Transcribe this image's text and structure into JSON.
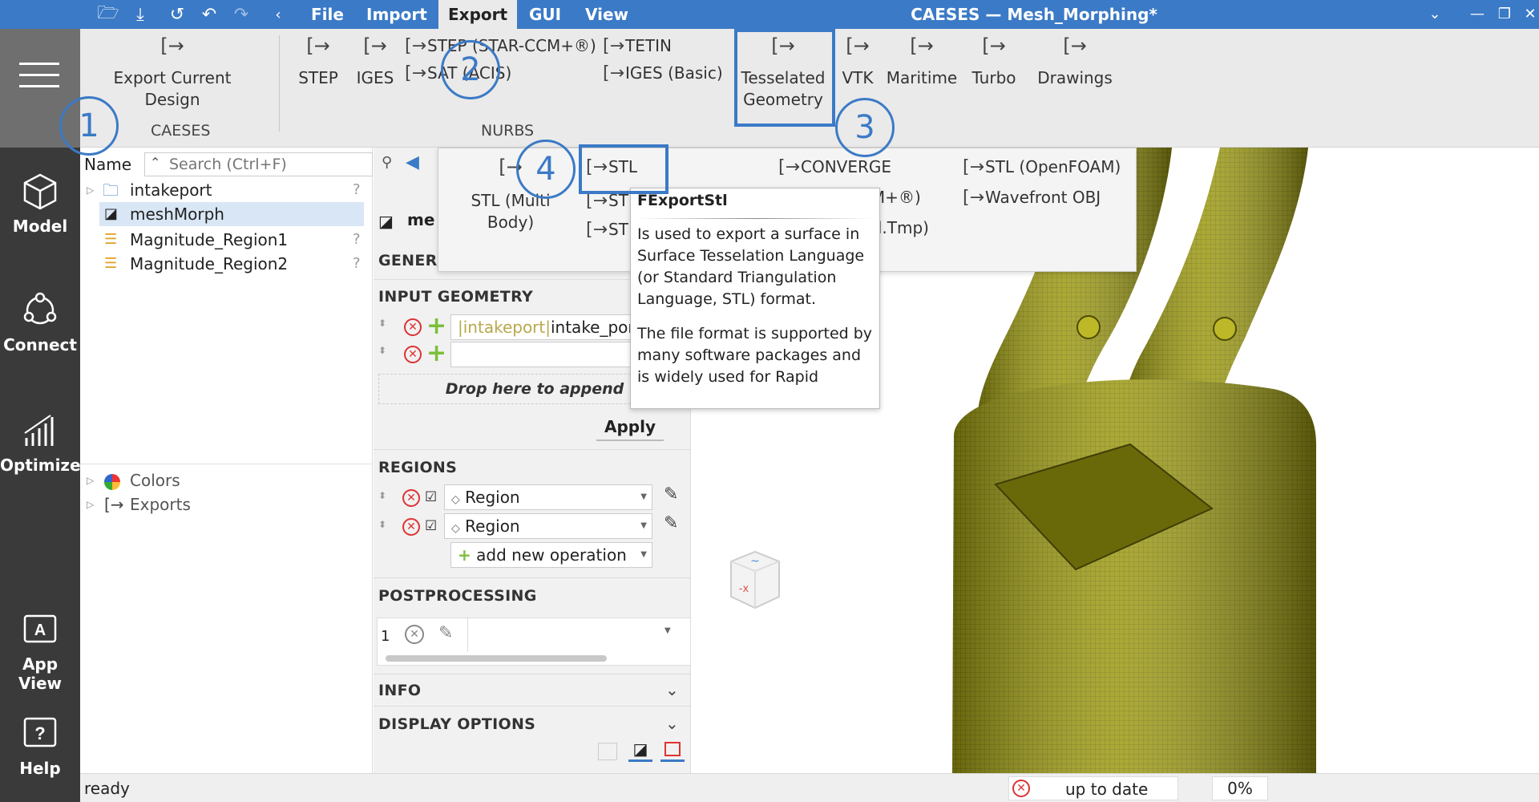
{
  "title_bar": {
    "menus": [
      "File",
      "Import",
      "Export",
      "GUI",
      "View"
    ],
    "title": "CAESES — Mesh_Morphing*"
  },
  "ribbon": {
    "caeses_group": {
      "export_current": "Export Current Design",
      "label": "CAESES"
    },
    "step": "STEP",
    "iges": "IGES",
    "step_star": "STEP (STAR-CCM+®)",
    "sat": "SAT (ACIS)",
    "tetin": "TETIN",
    "iges_basic": "IGES (Basic)",
    "nurbs_label": "NURBS",
    "tesselated": "Tesselated Geometry",
    "vtk": "VTK",
    "maritime": "Maritime",
    "turbo": "Turbo",
    "drawings": "Drawings"
  },
  "markers": [
    "1",
    "2",
    "3",
    "4"
  ],
  "sidebar": {
    "model": "Model",
    "connect": "Connect",
    "optimize": "Optimize",
    "app_view": "App View",
    "help": "Help"
  },
  "tree": {
    "name_header": "Name",
    "search_placeholder": "Search (Ctrl+F)",
    "items": [
      "intakeport",
      "meshMorph",
      "Magnitude_Region1",
      "Magnitude_Region2"
    ],
    "bottom_items": [
      "Colors",
      "Exports"
    ]
  },
  "dropdown": {
    "stl_multi": "STL (Multi Body)",
    "stl": "STL",
    "st2": "ST",
    "st3": "ST",
    "converge": "CONVERGE",
    "star_frag": "CCM+®)",
    "tmp_frag": "tl.Tmp)",
    "stl_openfoam": "STL (OpenFOAM)",
    "wavefront": "Wavefront OBJ"
  },
  "tooltip": {
    "title": "FExportStl",
    "p1": "Is used to export a surface in Surface Tesselation Language (or Standard Triangulation Language, STL) format.",
    "p2": "The file format is supported by many software packages and is widely used for Rapid"
  },
  "props": {
    "name_field": "me",
    "general": "GENER/",
    "input_geometry": "INPUT GEOMETRY",
    "ig_path_prefix": "|intakeport|",
    "ig_path": "intake_por",
    "drop_here": "Drop here to append",
    "apply": "Apply",
    "regions": "REGIONS",
    "region_values": [
      "Region",
      "Region"
    ],
    "add_op": "add new operation",
    "postprocessing": "POSTPROCESSING",
    "pp_index": "1",
    "info": "INFO",
    "display_options": "DISPLAY OPTIONS"
  },
  "status": {
    "text": "ready",
    "up_to_date": "up to date",
    "percent": "0%"
  },
  "colors": {
    "accent": "#3b7ac6",
    "mesh": "#9c9a12",
    "sidebar": "#3a3a3a"
  }
}
